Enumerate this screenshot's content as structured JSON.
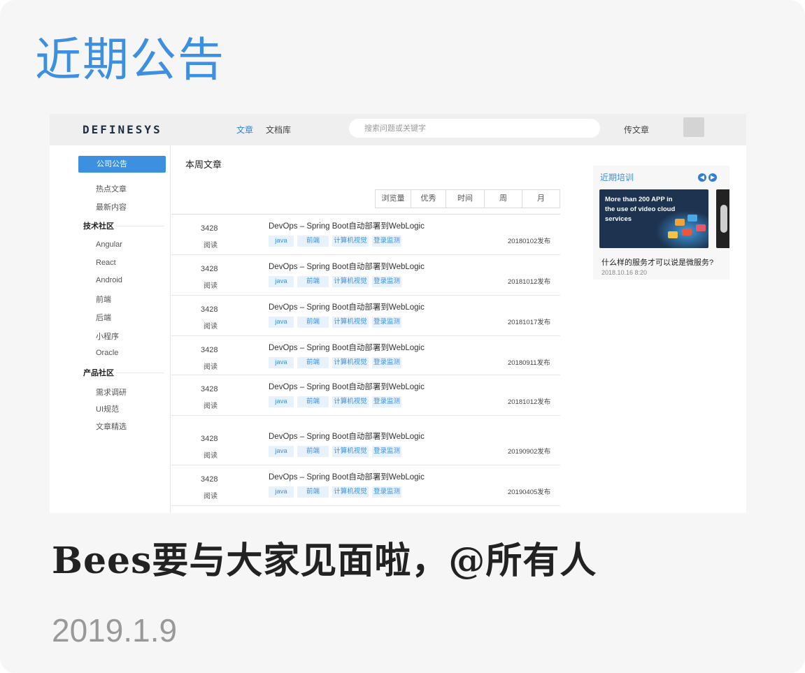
{
  "card": {
    "section_title": "近期公告",
    "headline": "Bees要与大家见面啦，@所有人",
    "date": "2019.1.9"
  },
  "nav": {
    "logo": "DEFINESYS",
    "links": [
      "文章",
      "文档库"
    ],
    "active_link": "文章",
    "search_placeholder": "搜索问题或关键字",
    "upload": "传文章"
  },
  "sidebar": {
    "active": "公司公告",
    "top_items": [
      "热点文章",
      "最新内容"
    ],
    "groups": [
      {
        "label": "技术社区",
        "items": [
          "Angular",
          "React",
          "Android",
          "前端",
          "后端",
          "小程序",
          "Oracle"
        ]
      },
      {
        "label": "产品社区",
        "items": [
          "需求调研",
          "UI规范",
          "文章精选"
        ]
      }
    ]
  },
  "main": {
    "section_title": "本周文章",
    "filters": [
      "浏览量",
      "优秀",
      "时间",
      "周",
      "月"
    ],
    "read_label": "阅读",
    "articles": [
      {
        "count": "3428",
        "title": "DevOps – Spring Boot自动部署到WebLogic",
        "tags": [
          "java",
          "前端",
          "计算机视觉",
          "登录监测"
        ],
        "date": "20180102发布"
      },
      {
        "count": "3428",
        "title": "DevOps – Spring Boot自动部署到WebLogic",
        "tags": [
          "java",
          "前端",
          "计算机视觉",
          "登录监测"
        ],
        "date": "20181012发布"
      },
      {
        "count": "3428",
        "title": "DevOps – Spring Boot自动部署到WebLogic",
        "tags": [
          "java",
          "前端",
          "计算机视觉",
          "登录监测"
        ],
        "date": "20181017发布"
      },
      {
        "count": "3428",
        "title": "DevOps – Spring Boot自动部署到WebLogic",
        "tags": [
          "java",
          "前端",
          "计算机视觉",
          "登录监测"
        ],
        "date": "20180911发布"
      },
      {
        "count": "3428",
        "title": "DevOps – Spring Boot自动部署到WebLogic",
        "tags": [
          "java",
          "前端",
          "计算机视觉",
          "登录监测"
        ],
        "date": "20181012发布"
      },
      {
        "count": "3428",
        "title": "DevOps – Spring Boot自动部署到WebLogic",
        "tags": [
          "java",
          "前端",
          "计算机视觉",
          "登录监测"
        ],
        "date": "20190902发布"
      },
      {
        "count": "3428",
        "title": "DevOps – Spring Boot自动部署到WebLogic",
        "tags": [
          "java",
          "前端",
          "计算机视觉",
          "登录监测"
        ],
        "date": "20190405发布"
      }
    ]
  },
  "training": {
    "title": "近期培训",
    "banner_text": "More than 200 APP in the use of video cloud services",
    "course_title": "什么样的服务才可以说是微服务?",
    "course_date": "2018.10.16 8:20",
    "prev_icon": "chevron-left-icon",
    "next_icon": "chevron-right-icon"
  },
  "colors": {
    "accent": "#3d8fe0",
    "tag_bg": "#e8f2fc",
    "nav_bg": "#efefef",
    "card_bg": "#f6f6f6"
  }
}
